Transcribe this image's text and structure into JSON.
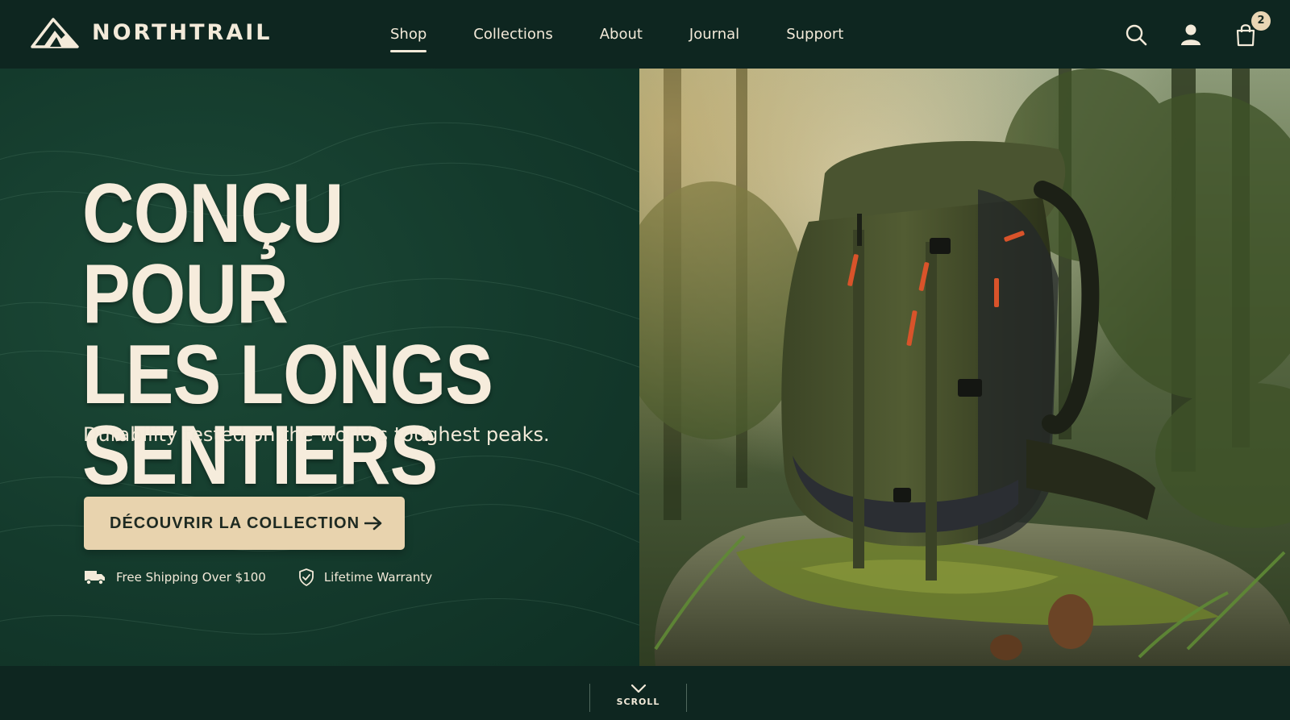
{
  "brand": {
    "name": "NORTHTRAIL",
    "logo_icon": "mountain-logo-icon"
  },
  "nav": {
    "items": [
      {
        "label": "Shop",
        "active": true
      },
      {
        "label": "Collections",
        "active": false
      },
      {
        "label": "About",
        "active": false
      },
      {
        "label": "Journal",
        "active": false
      },
      {
        "label": "Support",
        "active": false
      }
    ]
  },
  "header_actions": {
    "search_icon": "search-icon",
    "account_icon": "user-icon",
    "cart_icon": "shopping-bag-icon",
    "cart_count": "2"
  },
  "hero": {
    "headline_line1": "CONÇU POUR",
    "headline_line2": "LES LONGS",
    "headline_line3": "SENTIERS",
    "subheadline": "Durability tested on the world's toughest peaks.",
    "cta_label": "DÉCOUVRIR LA COLLECTION",
    "cta_icon": "arrow-right-icon",
    "badges": [
      {
        "icon": "truck-icon",
        "label": "Free Shipping Over $100"
      },
      {
        "icon": "shield-check-icon",
        "label": "Lifetime Warranty"
      }
    ],
    "image_subject": "olive green hiking backpack on mossy rock in forest"
  },
  "scroll_hint": {
    "label": "SCROLL",
    "icon": "chevron-down-icon"
  },
  "colors": {
    "header_bg": "#0e2620",
    "hero_bg": "#143a2c",
    "text_cream": "#f3ead9",
    "cta_bg": "#e8d3ae",
    "accent_orange": "#d9532a"
  }
}
